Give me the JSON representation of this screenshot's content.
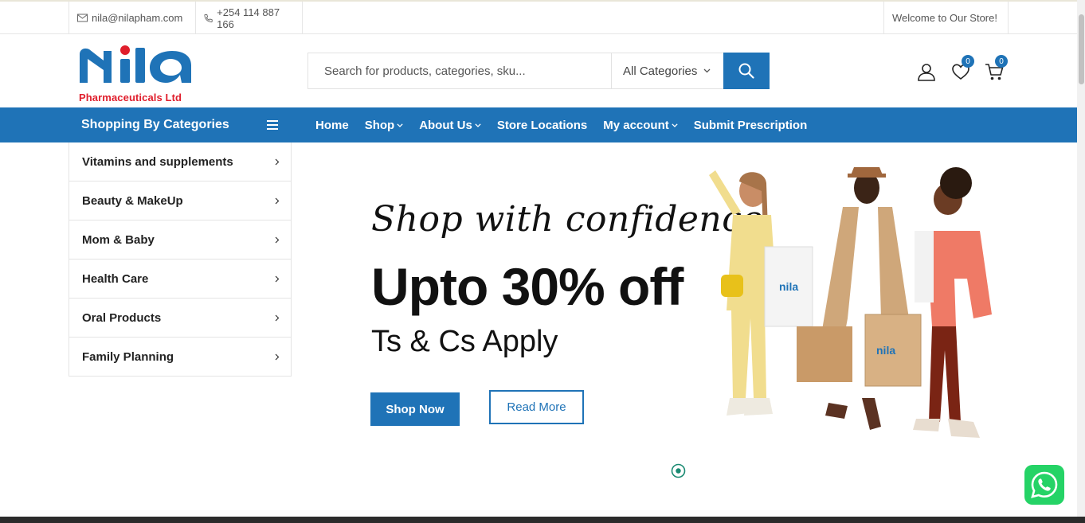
{
  "topbar": {
    "email": "nila@nilapham.com",
    "phone": "+254 114 887 166",
    "welcome": "Welcome to Our Store!"
  },
  "logo": {
    "word": "nila",
    "subtitle": "Pharmaceuticals Ltd",
    "brand_blue": "#1f73b7",
    "brand_red": "#e01e2c"
  },
  "search": {
    "placeholder": "Search for products, categories, sku...",
    "category_selected": "All Categories"
  },
  "header_icons": {
    "wishlist_count": "0",
    "cart_count": "0"
  },
  "nav": {
    "category_title": "Shopping By Categories",
    "links": [
      "Home",
      "Shop",
      "About Us",
      "Store Locations",
      "My account",
      "Submit Prescription"
    ]
  },
  "categories": [
    "Vitamins and supplements",
    "Beauty & MakeUp",
    "Mom & Baby",
    "Health Care",
    "Oral Products",
    "Family Planning"
  ],
  "hero": {
    "script_line": "Shop with confidence.",
    "headline": "Upto 30% off",
    "subline": "Ts & Cs Apply",
    "primary_button": "Shop Now",
    "secondary_button": "Read More",
    "bag_logo": "nila"
  },
  "colors": {
    "accent": "#1f73b7",
    "whatsapp": "#25d366",
    "slider_dot": "#1a8a72"
  }
}
